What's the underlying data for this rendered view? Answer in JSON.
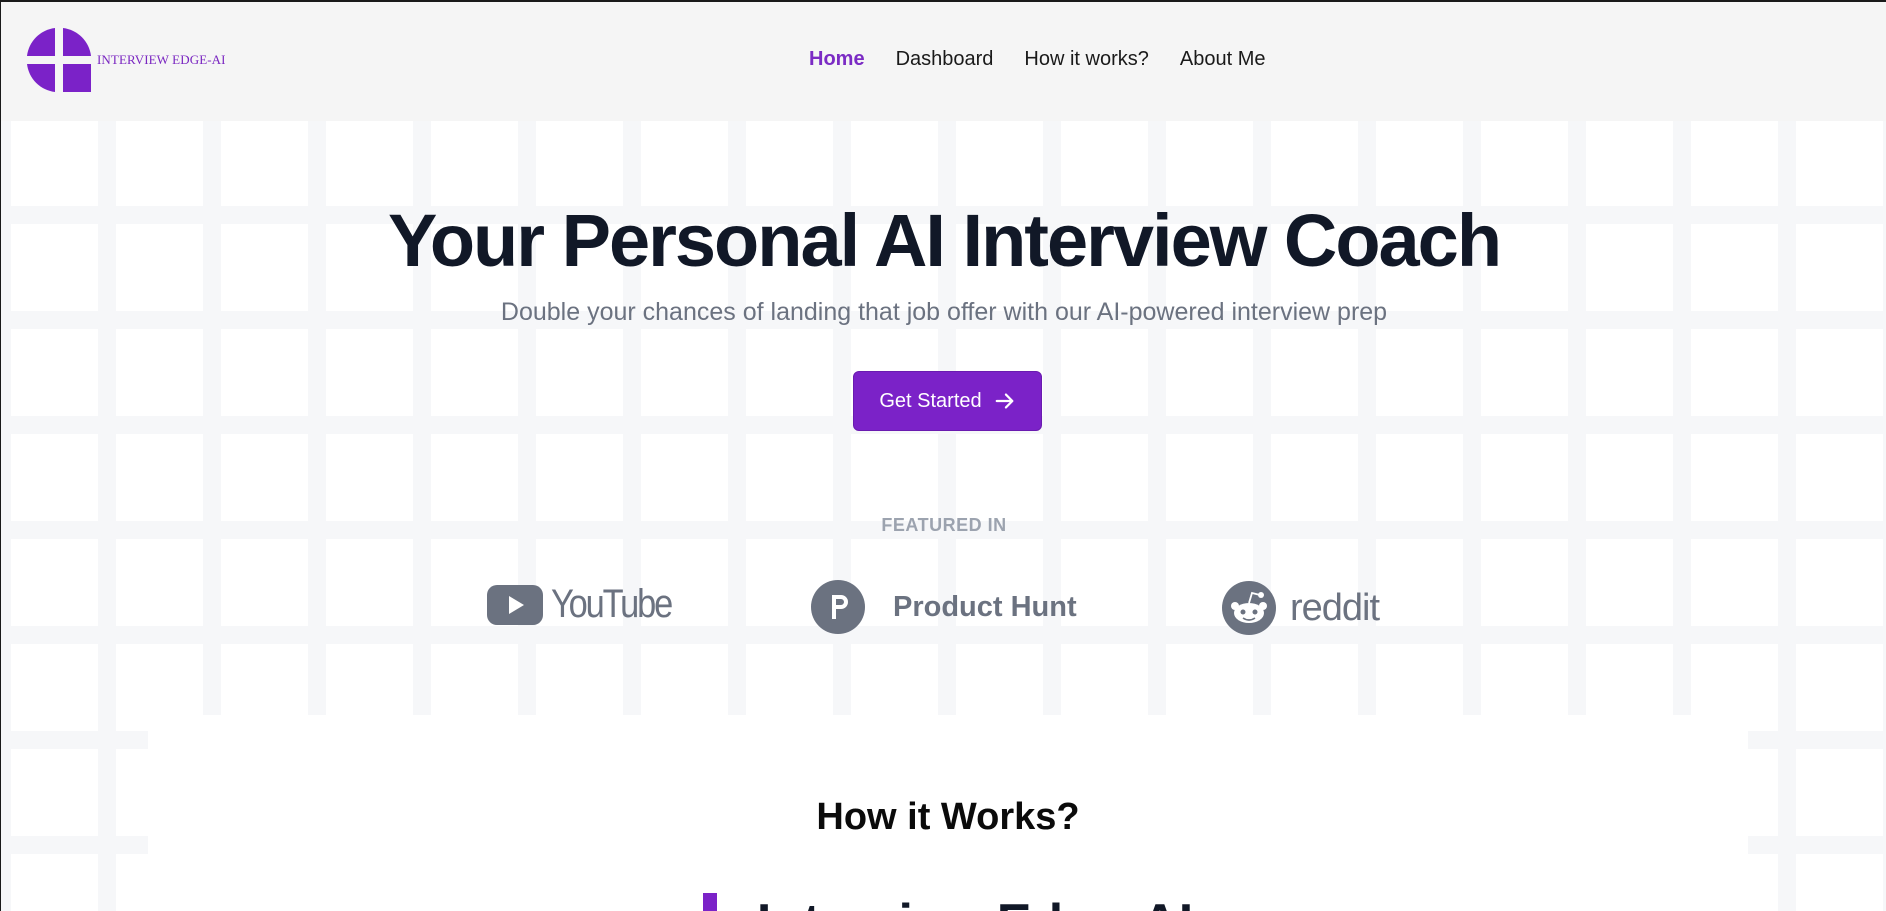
{
  "brand": {
    "name": "INTERVIEW EDGE-AI",
    "logo_icon": "quartered-circle-icon",
    "accent_color": "#7b22c8"
  },
  "nav": {
    "items": [
      {
        "label": "Home",
        "active": true
      },
      {
        "label": "Dashboard",
        "active": false
      },
      {
        "label": "How it works?",
        "active": false
      },
      {
        "label": "About Me",
        "active": false
      }
    ]
  },
  "hero": {
    "title": "Your Personal AI Interview Coach",
    "subtitle": "Double your chances of landing that job offer with our AI-powered interview prep",
    "cta_label": "Get Started",
    "cta_icon": "arrow-right-icon"
  },
  "featured": {
    "label": "FEATURED IN",
    "logos": [
      {
        "name": "YouTube",
        "icon": "youtube-play-icon"
      },
      {
        "name": "Product Hunt",
        "icon": "product-hunt-p-icon"
      },
      {
        "name": "reddit",
        "icon": "reddit-snoo-icon"
      }
    ]
  },
  "how_it_works": {
    "title": "How it Works?",
    "peek_text": "Interview Edge-AI"
  }
}
